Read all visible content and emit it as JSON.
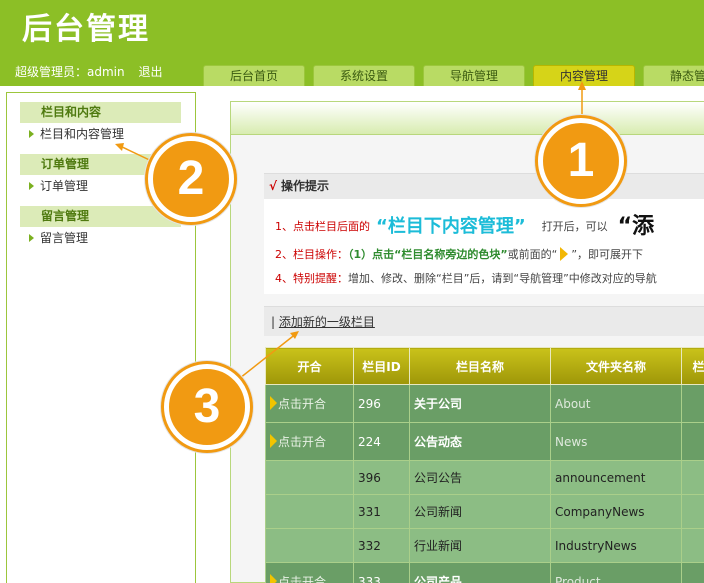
{
  "app": {
    "title": "后台管理"
  },
  "user": {
    "label": "超级管理员：admin",
    "logout": "退出"
  },
  "tabs": [
    {
      "label": "后台首页"
    },
    {
      "label": "系统设置"
    },
    {
      "label": "导航管理"
    },
    {
      "label": "内容管理",
      "active": true
    },
    {
      "label": "静态管理"
    }
  ],
  "sidebar": {
    "groups": [
      {
        "title": "栏目和内容",
        "items": [
          "栏目和内容管理"
        ]
      },
      {
        "title": "订单管理",
        "items": [
          "订单管理"
        ]
      },
      {
        "title": "留言管理",
        "items": [
          "留言管理"
        ]
      }
    ]
  },
  "tips": {
    "header_check": "√",
    "header": "操作提示",
    "line1": {
      "prefix": "1、点击栏目后面的",
      "highlight": "“栏目下内容管理”",
      "middle": "打开后，可以",
      "big": "“添"
    },
    "line2": {
      "prefix": "2、栏目操作：",
      "step": "（1）点击“栏目名称旁边的色块”",
      "middle": "或前面的“",
      "suffix": "”，即可展开下"
    },
    "line3": {
      "prefix": "4、特别提醒：",
      "text": "增加、修改、删除“栏目”后，请到“导航管理”中修改对应的导航"
    }
  },
  "actions": {
    "pipe": "|",
    "add_label": "添加新的一级栏目"
  },
  "table": {
    "headers": [
      "开合",
      "栏目ID",
      "栏目名称",
      "文件夹名称",
      "栏"
    ],
    "rows": [
      {
        "type": "parent",
        "toggle": "点击开合",
        "id": "296",
        "name": "关于公司",
        "folder": "About",
        "extra": ""
      },
      {
        "type": "parent",
        "toggle": "点击开合",
        "id": "224",
        "name": "公告动态",
        "folder": "News",
        "extra": ""
      },
      {
        "type": "child",
        "toggle": "",
        "id": "396",
        "name": "公司公告",
        "folder": "announcement",
        "extra": ""
      },
      {
        "type": "child",
        "toggle": "",
        "id": "331",
        "name": "公司新闻",
        "folder": "CompanyNews",
        "extra": ""
      },
      {
        "type": "child",
        "toggle": "",
        "id": "332",
        "name": "行业新闻",
        "folder": "IndustryNews",
        "extra": ""
      },
      {
        "type": "parent",
        "toggle": "点击开合",
        "id": "333",
        "name": "公司产品",
        "folder": "Product",
        "extra": ""
      }
    ]
  },
  "callouts": [
    "1",
    "2",
    "3"
  ],
  "colors": {
    "header_green": "#8cbf26",
    "callout_orange": "#f19a12",
    "active_tab": "#d6d418",
    "table_header": "#b8b010",
    "parent_row": "#6a9e66",
    "child_row": "#8cbd84"
  }
}
